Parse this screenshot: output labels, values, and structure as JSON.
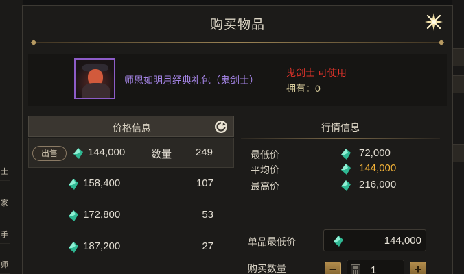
{
  "dialog": {
    "title": "购买物品"
  },
  "item": {
    "name": "师恩如明月经典礼包（鬼剑士）",
    "usable": "鬼剑士 可使用",
    "owned": "拥有：0"
  },
  "price_panel": {
    "header": "价格信息",
    "sell_label": "出售",
    "quantity_label": "数量",
    "rows": [
      {
        "price": "144,000",
        "quantity": "249"
      },
      {
        "price": "158,400",
        "quantity": "107"
      },
      {
        "price": "172,800",
        "quantity": "53"
      },
      {
        "price": "187,200",
        "quantity": "27"
      }
    ]
  },
  "market_panel": {
    "header": "行情信息",
    "min_label": "最低价",
    "min_value": "72,000",
    "avg_label": "平均价",
    "avg_value": "144,000",
    "max_label": "最高价",
    "max_value": "216,000",
    "unit_min_label": "单品最低价",
    "unit_min_value": "144,000",
    "buy_qty_label": "购买数量",
    "buy_qty_value": "1",
    "minus": "−",
    "plus": "+"
  },
  "background": {
    "left_tabs": [
      "士",
      "家",
      "手",
      "师"
    ]
  },
  "colors": {
    "item_name": "#a484e6",
    "usable": "#e0332a",
    "avg_price": "#f2b237",
    "gem": "#3fd3b0"
  },
  "icons": {
    "close": "close-star-icon",
    "refresh": "refresh-icon",
    "gem": "gem-icon",
    "calculator": "calculator-icon"
  }
}
